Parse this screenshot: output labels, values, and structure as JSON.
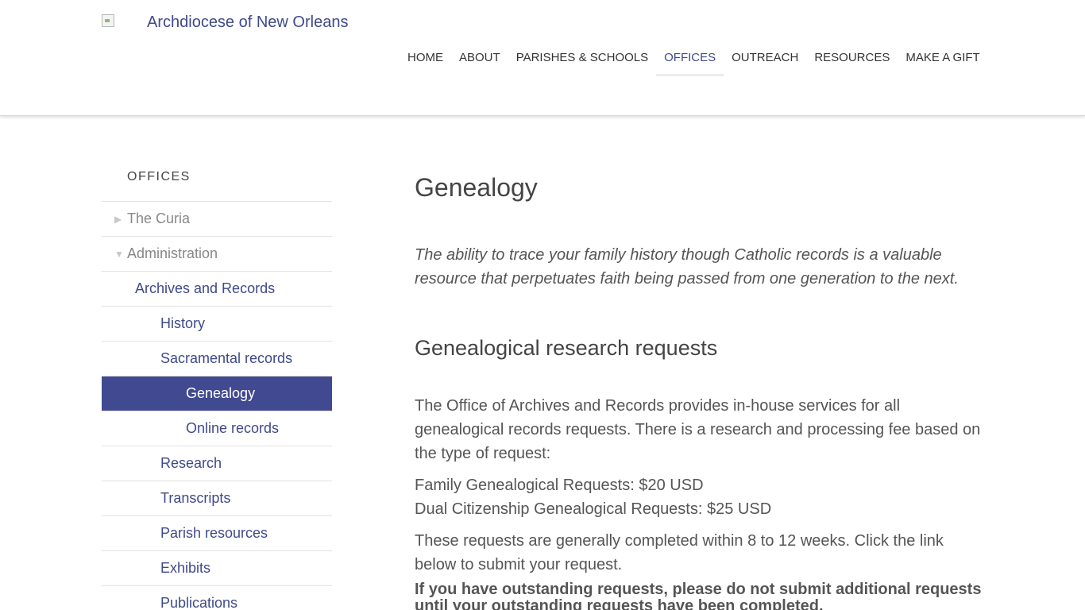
{
  "header": {
    "site_title": "Archdiocese of New Orleans",
    "nav": [
      {
        "label": "HOME"
      },
      {
        "label": "ABOUT"
      },
      {
        "label": "PARISHES & SCHOOLS"
      },
      {
        "label": "OFFICES",
        "active": true
      },
      {
        "label": "OUTREACH"
      },
      {
        "label": "RESOURCES"
      },
      {
        "label": "MAKE A GIFT"
      }
    ]
  },
  "sidebar": {
    "heading": "OFFICES",
    "items": [
      {
        "label": "The Curia",
        "caret": "▶"
      },
      {
        "label": "Administration",
        "caret": "▼"
      },
      {
        "label": "Archives and Records"
      },
      {
        "label": "History"
      },
      {
        "label": "Sacramental records"
      },
      {
        "label": "Genealogy",
        "active": true
      },
      {
        "label": "Online records"
      },
      {
        "label": "Research"
      },
      {
        "label": "Transcripts"
      },
      {
        "label": "Parish resources"
      },
      {
        "label": "Exhibits"
      },
      {
        "label": "Publications"
      }
    ]
  },
  "main": {
    "title": "Genealogy",
    "intro": "The ability to trace your family history though Catholic records is a valuable resource that perpetuates faith being passed from one generation to the next.",
    "section_title": "Genealogical research requests",
    "paragraph1": "The Office of Archives and Records provides in-house services for all genealogical records requests. There is a research and processing fee based on the type of request:",
    "fee_family": "Family Genealogical Requests:  $20 USD",
    "fee_dual": "Dual Citizenship Genealogical Requests:  $25 USD",
    "paragraph2": "These requests are generally completed within 8 to 12 weeks. Click the link below to submit your request.",
    "bold_note": "If you have outstanding requests, please do not submit additional requests until your outstanding requests have been completed."
  },
  "colors": {
    "brand": "#3f4a8a",
    "active_bg": "#414990"
  }
}
